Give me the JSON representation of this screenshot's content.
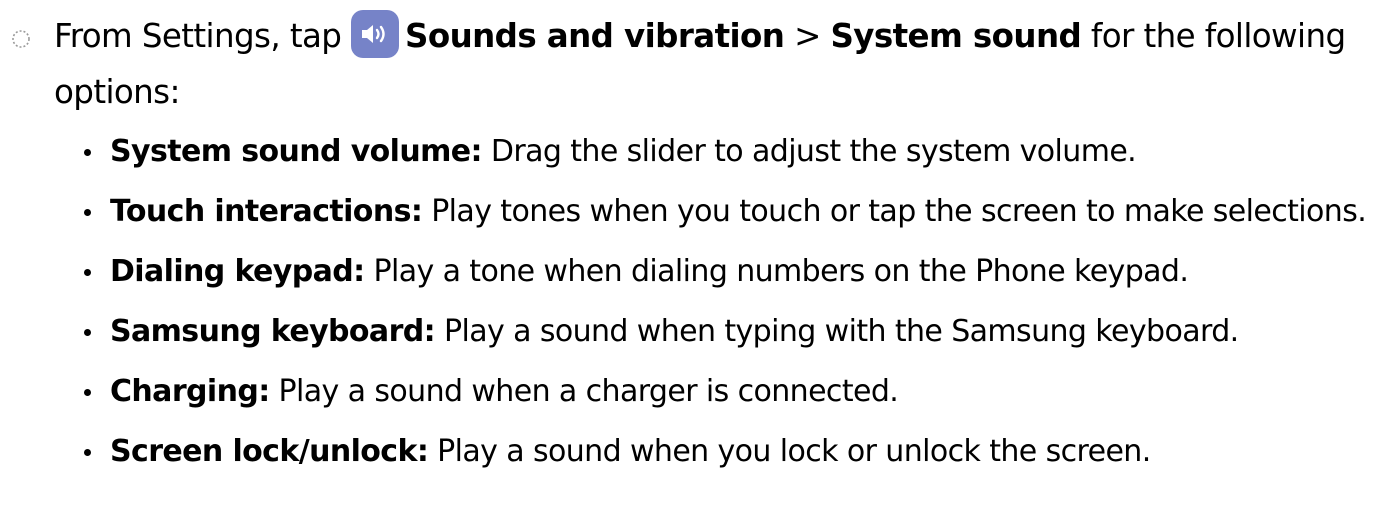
{
  "step": {
    "prefix": "From Settings, tap",
    "icon": "sound-speaker-icon",
    "icon_color": "#7683c8",
    "menu": "Sounds and vibration",
    "separator": ">",
    "submenu": "System sound",
    "suffix": "for the following options:"
  },
  "options": [
    {
      "term": "System sound volume",
      "colon": ":",
      "desc": "Drag the slider to adjust the system volume."
    },
    {
      "term": "Touch interactions",
      "colon": ":",
      "desc": "Play tones when you touch or tap the screen to make selections."
    },
    {
      "term": "Dialing keypad",
      "colon": ":",
      "desc": "Play a tone when dialing numbers on the Phone keypad."
    },
    {
      "term": "Samsung keyboard",
      "colon": ":",
      "desc": "Play a sound when typing with the Samsung keyboard."
    },
    {
      "term": "Charging",
      "colon": ":",
      "desc": "Play a sound when a charger is connected."
    },
    {
      "term": "Screen lock/unlock",
      "colon": ":",
      "desc": "Play a sound when you lock or unlock the screen."
    }
  ]
}
